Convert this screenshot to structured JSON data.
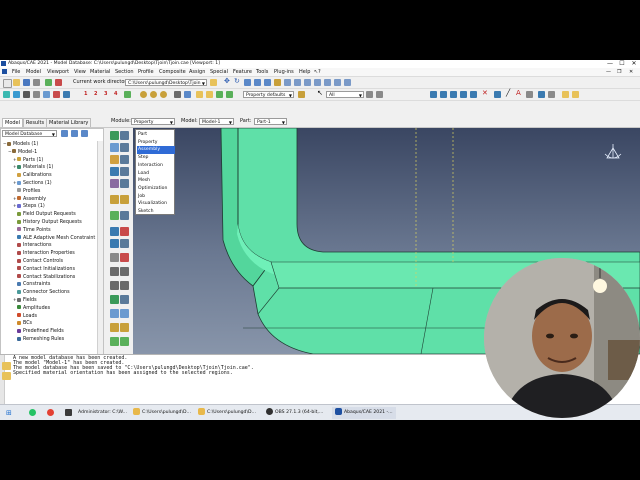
{
  "window": {
    "title": "Abaqus/CAE 2021 - Model Database: C:\\Users\\pulungd\\Desktop\\Tjoin\\Tjoin.cae [Viewport: 1]",
    "minimize": "—",
    "maximize": "☐",
    "close": "✕"
  },
  "menubar": {
    "items": [
      "File",
      "Model",
      "Viewport",
      "View",
      "Material",
      "Section",
      "Profile",
      "Composite",
      "Assign",
      "Special",
      "Feature",
      "Tools",
      "Plug-ins",
      "Help"
    ],
    "help_icon": "?"
  },
  "toolbar1": {
    "cwd_label": "Current work directory:",
    "cwd_value": "C:\\Users\\pulungd\\Desktop\\Tjoin"
  },
  "toolbar2": {
    "num_buttons": [
      "1",
      "2",
      "3",
      "4"
    ],
    "property_defaults": "Property defaults",
    "select_value": "All"
  },
  "context_bar": {
    "module_label": "Module:",
    "module_value": "Property",
    "model_label": "Model:",
    "model_value": "Model-1",
    "part_label": "Part:",
    "part_value": "Part-1"
  },
  "module_dropdown": {
    "options": [
      "Part",
      "Property",
      "Assembly",
      "Step",
      "Interaction",
      "Load",
      "Mesh",
      "Optimization",
      "Job",
      "Visualization",
      "Sketch"
    ],
    "selected_index": 2
  },
  "left_tabs": [
    "Model",
    "Results",
    "Material Library"
  ],
  "tree_combo": "Model Database",
  "tree": {
    "nodes": [
      {
        "label": "Models (1)",
        "indent": 0,
        "expander": "−",
        "color": "#8a6a3a"
      },
      {
        "label": "Model-1",
        "indent": 1,
        "expander": "−",
        "color": "#8a6a3a"
      },
      {
        "label": "Parts (1)",
        "indent": 2,
        "expander": "+",
        "color": "#c8a23a"
      },
      {
        "label": "Materials (1)",
        "indent": 2,
        "expander": "+",
        "color": "#3a8a6a"
      },
      {
        "label": "Calibrations",
        "indent": 2,
        "expander": "",
        "color": "#d0a040"
      },
      {
        "label": "Sections (1)",
        "indent": 2,
        "expander": "+",
        "color": "#6a9ad0"
      },
      {
        "label": "Profiles",
        "indent": 2,
        "expander": "",
        "color": "#9a9a9a"
      },
      {
        "label": "Assembly",
        "indent": 2,
        "expander": "+",
        "color": "#c06a30"
      },
      {
        "label": "Steps (1)",
        "indent": 2,
        "expander": "+",
        "color": "#6a6ad0"
      },
      {
        "label": "Field Output Requests",
        "indent": 2,
        "expander": "",
        "color": "#7a9a3a"
      },
      {
        "label": "History Output Requests",
        "indent": 2,
        "expander": "",
        "color": "#7a9a3a"
      },
      {
        "label": "Time Points",
        "indent": 2,
        "expander": "",
        "color": "#9a6a9a"
      },
      {
        "label": "ALE Adaptive Mesh Constraint",
        "indent": 2,
        "expander": "",
        "color": "#3a7ab0"
      },
      {
        "label": "Interactions",
        "indent": 2,
        "expander": "",
        "color": "#b04a4a"
      },
      {
        "label": "Interaction Properties",
        "indent": 2,
        "expander": "",
        "color": "#b04a4a"
      },
      {
        "label": "Contact Controls",
        "indent": 2,
        "expander": "",
        "color": "#b04a4a"
      },
      {
        "label": "Contact Initializations",
        "indent": 2,
        "expander": "",
        "color": "#b04a4a"
      },
      {
        "label": "Contact Stabilizations",
        "indent": 2,
        "expander": "",
        "color": "#b04a4a"
      },
      {
        "label": "Constraints",
        "indent": 2,
        "expander": "",
        "color": "#4a7ab0"
      },
      {
        "label": "Connector Sections",
        "indent": 2,
        "expander": "",
        "color": "#4a9a9a"
      },
      {
        "label": "Fields",
        "indent": 2,
        "expander": "+",
        "color": "#6a6a6a"
      },
      {
        "label": "Amplitudes",
        "indent": 2,
        "expander": "",
        "color": "#3a8a3a"
      },
      {
        "label": "Loads",
        "indent": 2,
        "expander": "",
        "color": "#d04a2a"
      },
      {
        "label": "BCs",
        "indent": 2,
        "expander": "",
        "color": "#d08a2a"
      },
      {
        "label": "Predefined Fields",
        "indent": 2,
        "expander": "",
        "color": "#6a3a9a"
      },
      {
        "label": "Remeshing Rules",
        "indent": 2,
        "expander": "",
        "color": "#3a6a9a"
      }
    ]
  },
  "messages": {
    "lines": [
      "A new model database has been created.",
      "The model \"Model-1\" has been created.",
      "The model database has been saved to \"C:\\Users\\pulungd\\Desktop\\Tjoin\\Tjoin.cae\".",
      "Specified material orientation has been assigned to the selected regions."
    ]
  },
  "taskbar": {
    "items": [
      {
        "label": "Administrator: C:\\W...",
        "color": "#222222"
      },
      {
        "label": "C:\\Users\\pulungd\\D...",
        "color": "#e8b84a"
      },
      {
        "label": "C:\\Users\\pulungd\\D...",
        "color": "#e8b84a"
      },
      {
        "label": "OBS 27.1.3 (64-bit,...",
        "color": "#303030"
      },
      {
        "label": "Abaqus/CAE 2021 -...",
        "color": "#1d4fa0"
      }
    ]
  },
  "colors": {
    "part_fill": "#5fe0a8",
    "part_edge": "#1e3d32",
    "viewport_top": "#3a4662",
    "viewport_bottom": "#8895aa",
    "selection": "#2f6bd6"
  }
}
